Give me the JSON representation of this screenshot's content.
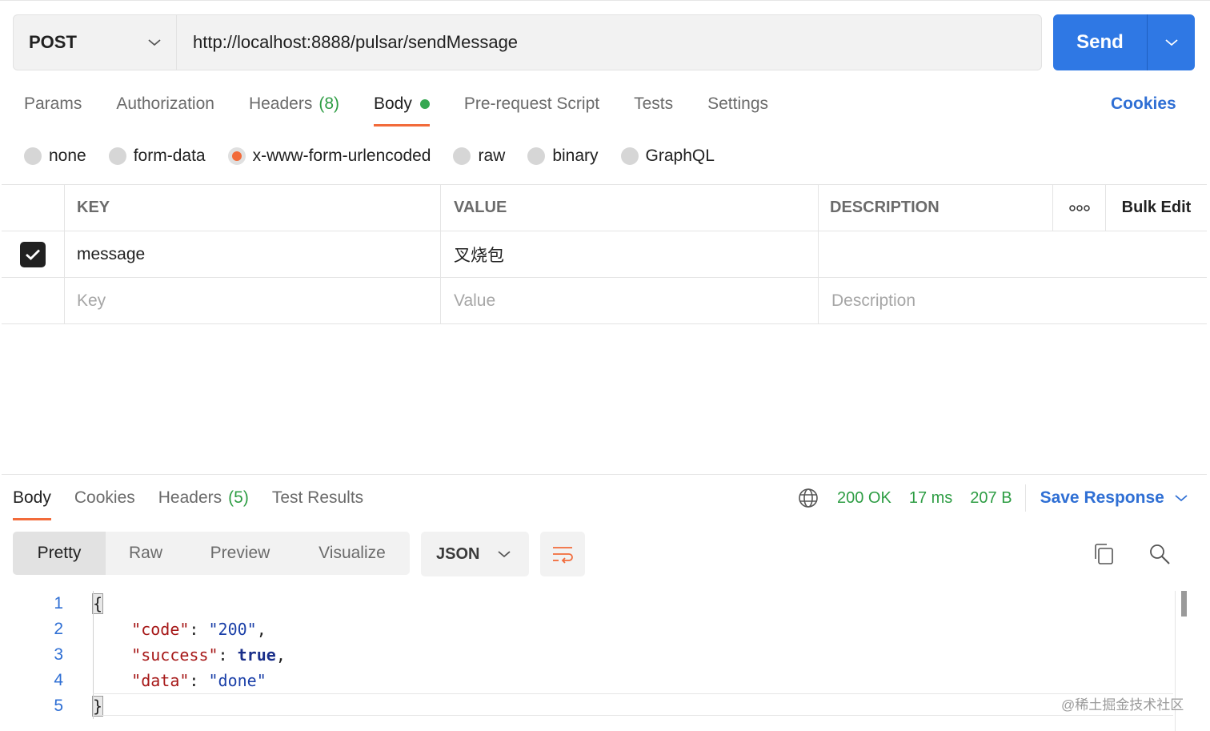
{
  "request": {
    "method": "POST",
    "url": "http://localhost:8888/pulsar/sendMessage",
    "send_label": "Send"
  },
  "request_tabs": [
    {
      "label": "Params",
      "count": ""
    },
    {
      "label": "Authorization",
      "count": ""
    },
    {
      "label": "Headers",
      "count": "(8)"
    },
    {
      "label": "Body",
      "count": "",
      "active": true
    },
    {
      "label": "Pre-request Script",
      "count": ""
    },
    {
      "label": "Tests",
      "count": ""
    },
    {
      "label": "Settings",
      "count": ""
    }
  ],
  "cookies_label": "Cookies",
  "body_types": [
    "none",
    "form-data",
    "x-www-form-urlencoded",
    "raw",
    "binary",
    "GraphQL"
  ],
  "body_type_selected": "x-www-form-urlencoded",
  "table": {
    "headers": {
      "key": "KEY",
      "value": "VALUE",
      "description": "DESCRIPTION",
      "more": "ooo",
      "bulk_edit": "Bulk Edit"
    },
    "rows": [
      {
        "checked": true,
        "key": "message",
        "value": "叉烧包",
        "description": ""
      }
    ],
    "placeholders": {
      "key": "Key",
      "value": "Value",
      "description": "Description"
    }
  },
  "response_tabs": [
    {
      "label": "Body",
      "count": ""
    },
    {
      "label": "Cookies",
      "count": ""
    },
    {
      "label": "Headers",
      "count": "(5)"
    },
    {
      "label": "Test Results",
      "count": ""
    }
  ],
  "status": {
    "code": "200 OK",
    "time": "17 ms",
    "size": "207 B",
    "save_label": "Save Response"
  },
  "view_modes": [
    "Pretty",
    "Raw",
    "Preview",
    "Visualize"
  ],
  "format": "JSON",
  "code_lines": [
    "1",
    "2",
    "3",
    "4",
    "5"
  ],
  "response_json": {
    "code_key": "\"code\"",
    "code_val": "\"200\"",
    "success_key": "\"success\"",
    "success_val": "true",
    "data_key": "\"data\"",
    "data_val": "\"done\""
  },
  "watermark": "@稀土掘金技术社区",
  "colors": {
    "accent": "#2f78e4",
    "active_tab": "#f26b3a",
    "success": "#2e9d44"
  }
}
